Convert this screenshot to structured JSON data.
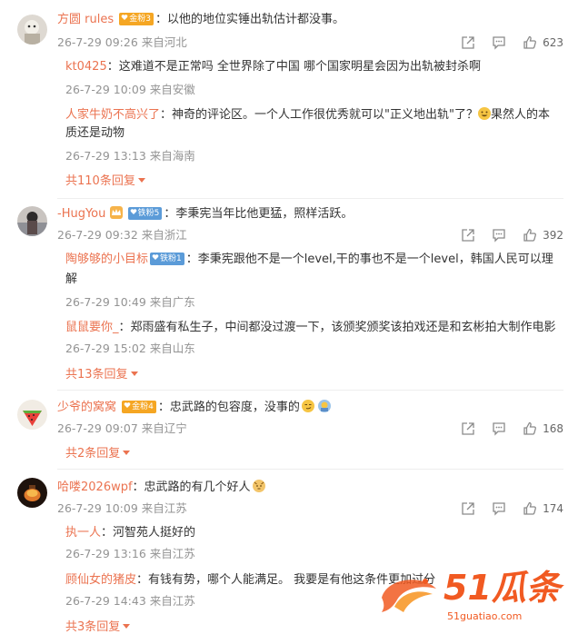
{
  "comments": [
    {
      "username": "方圆 rules",
      "badge": "金粉3",
      "content": "：以他的地位实锤出轨估计都没事。",
      "meta": "26-7-29 09:26 来自河北",
      "likes": "623",
      "replies": [
        {
          "username": "kt0425",
          "content": "：这难道不是正常吗 全世界除了中国 哪个国家明星会因为出轨被封杀啊",
          "meta": "26-7-29 10:09 来自安徽"
        },
        {
          "username": "人家牛奶不高兴了",
          "content_line1": "：神奇的评论区。一个人工作很优秀就可以\"正义地出轨\"了？",
          "content_line1_after": "果然人的本",
          "content_line2": "质还是动物",
          "meta": "26-7-29 13:13 来自海南"
        }
      ],
      "more": "共110条回复"
    },
    {
      "username": "-HugYou",
      "badge": "铁粉5",
      "content": "：李秉宪当年比他更猛，照样活跃。",
      "meta": "26-7-29 09:32 来自浙江",
      "likes": "392",
      "replies": [
        {
          "username": "陶够够的小目标",
          "badge": "铁粉1",
          "content_line1": "：李秉宪跟他不是一个level,干的事也不是一个level，韩国人民可以理",
          "content_line2": "解",
          "meta": "26-7-29 10:49 来自广东"
        },
        {
          "username": "鼠鼠要你_",
          "content": "：郑雨盛有私生子，中间都没过渡一下，该颁奖颁奖该拍戏还是和玄彬拍大制作电影",
          "meta": "26-7-29 15:02 来自山东"
        }
      ],
      "more": "共13条回复"
    },
    {
      "username": "少爷的窝窝",
      "badge": "金粉4",
      "content": "：忠武路的包容度，没事的",
      "meta": "26-7-29 09:07 来自辽宁",
      "likes": "168",
      "more": "共2条回复"
    },
    {
      "username": "哈喽2026wpf",
      "content": "：忠武路的有几个好人",
      "meta": "26-7-29 10:09 来自江苏",
      "likes": "174",
      "replies": [
        {
          "username": "执一人",
          "content": "：河智苑人挺好的",
          "meta": "26-7-29 13:16 来自江苏"
        },
        {
          "username": "顾仙女的猪皮",
          "content": "：有钱有势，哪个人能满足。 我要是有他这条件更加过分",
          "meta": "26-7-29 14:43 来自江苏"
        }
      ],
      "more": "共3条回复"
    }
  ],
  "watermark": {
    "brand": "51瓜条",
    "url": "51guatiao.com"
  },
  "colors": {
    "username": "#eb7350",
    "meta": "#939393",
    "watermark": "#f15a22"
  }
}
